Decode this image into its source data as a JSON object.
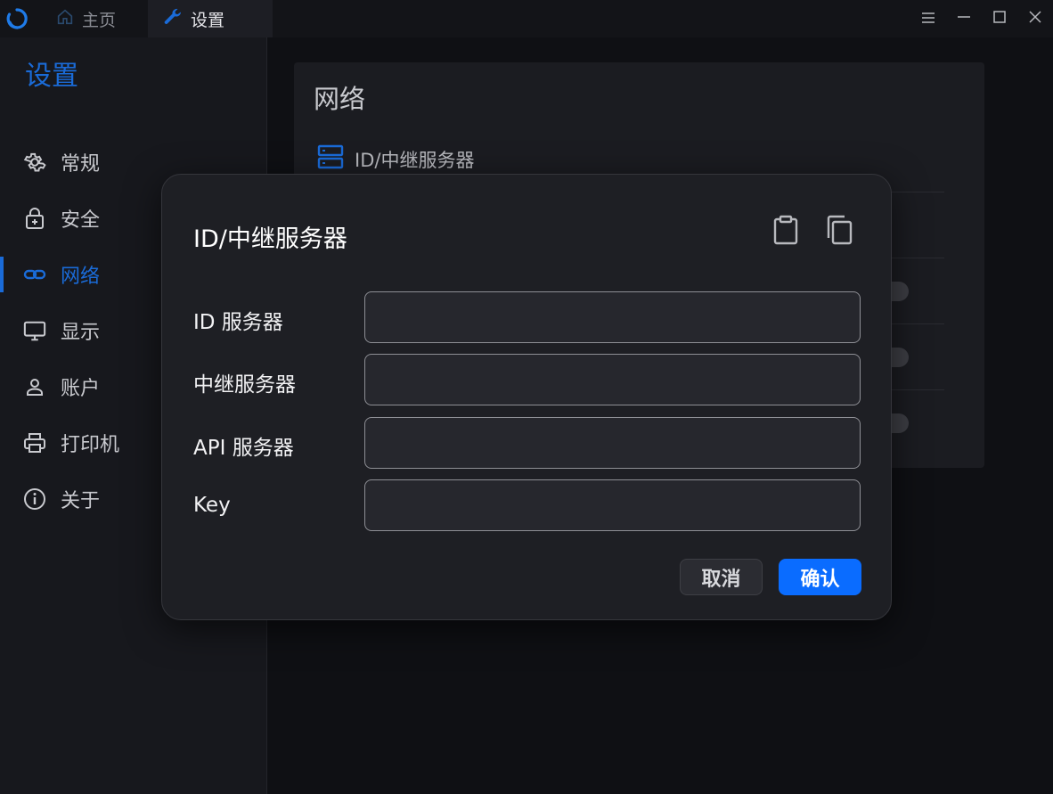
{
  "titlebar": {
    "tabs": [
      {
        "label": "主页",
        "icon": "home-icon"
      },
      {
        "label": "设置",
        "icon": "wrench-icon"
      }
    ]
  },
  "sidebar": {
    "title": "设置",
    "items": [
      {
        "label": "常规",
        "icon": "gear-icon"
      },
      {
        "label": "安全",
        "icon": "lock-icon"
      },
      {
        "label": "网络",
        "icon": "link-icon",
        "active": true
      },
      {
        "label": "显示",
        "icon": "monitor-icon"
      },
      {
        "label": "账户",
        "icon": "person-icon"
      },
      {
        "label": "打印机",
        "icon": "printer-icon"
      },
      {
        "label": "关于",
        "icon": "info-icon"
      }
    ]
  },
  "network": {
    "title": "网络",
    "rows": [
      {
        "label": "ID/中继服务器",
        "icon": "server-icon"
      }
    ]
  },
  "dialog": {
    "title": "ID/中继服务器",
    "fields": [
      {
        "label": "ID 服务器",
        "value": ""
      },
      {
        "label": "中继服务器",
        "value": ""
      },
      {
        "label": "API 服务器",
        "value": ""
      },
      {
        "label": "Key",
        "value": ""
      }
    ],
    "cancel_label": "取消",
    "ok_label": "确认"
  },
  "colors": {
    "accent": "#1a6bd8",
    "primary_button": "#0a6cff"
  }
}
